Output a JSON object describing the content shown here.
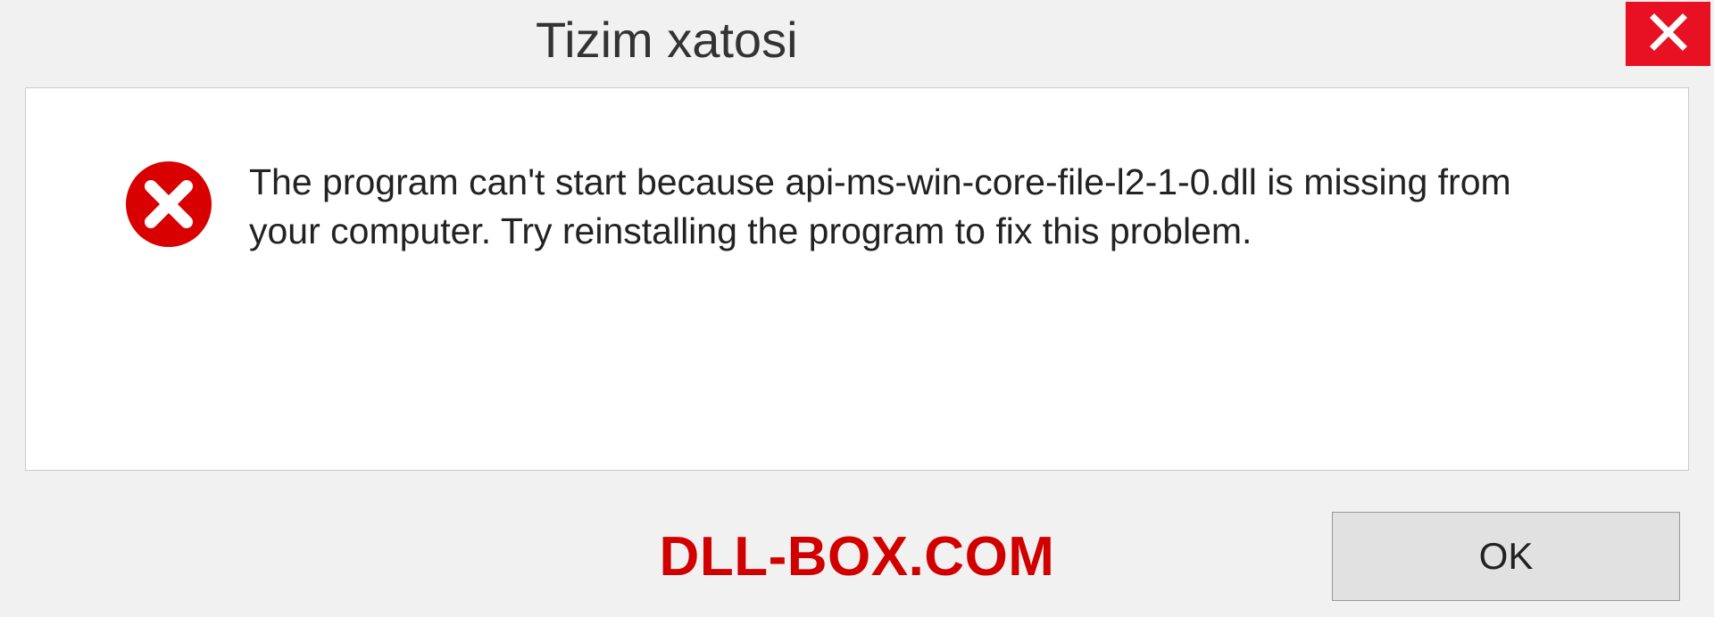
{
  "dialog": {
    "title": "Tizim xatosi",
    "message": "The program can't start because api-ms-win-core-file-l2-1-0.dll is missing from your computer. Try reinstalling the program to fix this problem.",
    "ok_label": "OK"
  },
  "watermark": "DLL-BOX.COM",
  "icons": {
    "close": "close-icon",
    "error": "error-icon"
  },
  "colors": {
    "close_bg": "#e81123",
    "error_red": "#d80000",
    "watermark_red": "#d10000"
  }
}
